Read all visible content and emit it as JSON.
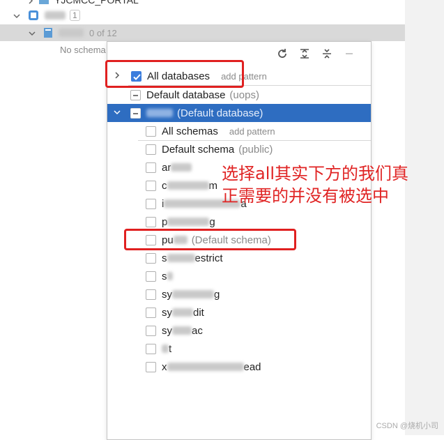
{
  "tree": {
    "top_partial_label": "YJCMCC_PORTAL",
    "datasource_badge": "1",
    "selected_schema_count": "0 of 12",
    "no_schema_text": "No schema"
  },
  "popup": {
    "toolbar": [
      "refresh",
      "expand-all",
      "collapse-all",
      "minus"
    ],
    "all_databases": {
      "label": "All databases",
      "add_pattern": "add pattern"
    },
    "default_database": {
      "label": "Default database",
      "suffix": "(uops)"
    },
    "current_db": {
      "suffix": "(Default database)"
    },
    "all_schemas": {
      "label": "All schemas",
      "add_pattern": "add pattern"
    },
    "default_schema": {
      "label": "Default schema",
      "suffix": "(public)"
    },
    "schemas": [
      {
        "prefix": "ar",
        "suffix": ""
      },
      {
        "prefix": "c",
        "suffix": "m"
      },
      {
        "prefix": "i",
        "suffix": "a"
      },
      {
        "prefix": "p",
        "suffix": "g"
      },
      {
        "prefix": "pu",
        "suffix": "(Default schema)"
      },
      {
        "prefix": "s",
        "suffix": "estrict"
      },
      {
        "prefix": "s",
        "suffix": ""
      },
      {
        "prefix": "sy",
        "suffix": "g"
      },
      {
        "prefix": "sy",
        "suffix": "dit"
      },
      {
        "prefix": "sy",
        "suffix": "ac"
      },
      {
        "prefix": "",
        "suffix": "t"
      },
      {
        "prefix": "x",
        "suffix": "ead"
      }
    ]
  },
  "annotation": {
    "line1": "选择all其实下方的我们真",
    "line2": "正需要的并没有被选中"
  },
  "watermark": "CSDN @烧机小司",
  "colors": {
    "highlight": "#2e6dc1",
    "annotation": "#e02424",
    "checkbox_checked": "#3b7ddd"
  }
}
